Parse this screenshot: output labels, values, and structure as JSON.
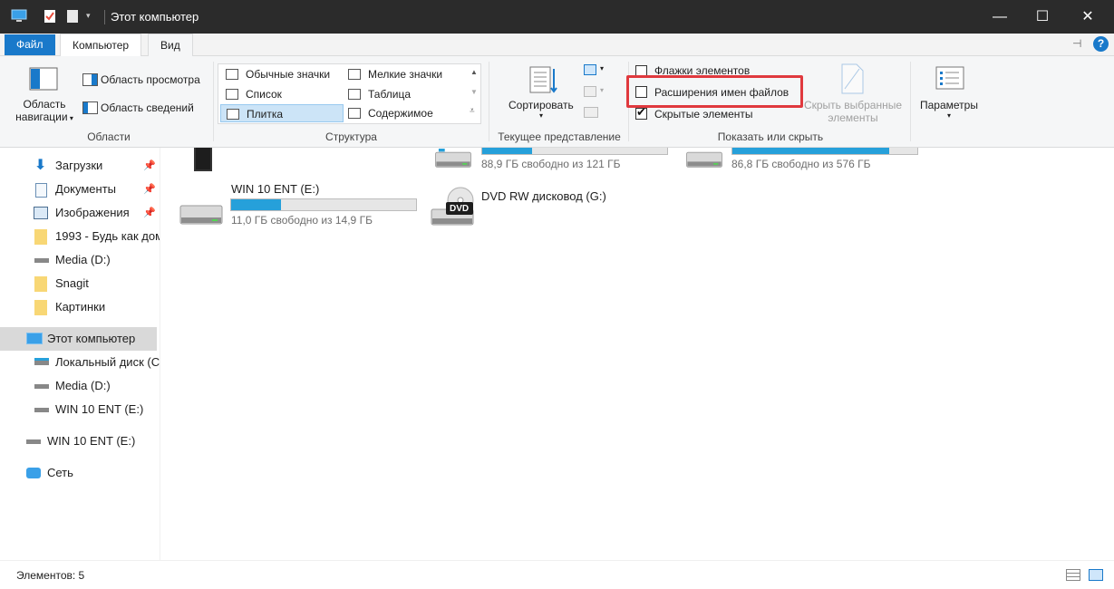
{
  "window": {
    "title": "Этот компьютер"
  },
  "tabs": [
    "Файл",
    "Компьютер",
    "Вид"
  ],
  "ribbon": {
    "panes": {
      "nav_pane": "Область навигации",
      "nav_pane_line1": "Область",
      "nav_pane_line2": "навигации",
      "preview": "Область просмотра",
      "details": "Область сведений",
      "group": "Области"
    },
    "layout": {
      "items": [
        "Обычные значки",
        "Мелкие значки",
        "Список",
        "Таблица",
        "Плитка",
        "Содержимое"
      ],
      "selected": "Плитка",
      "group": "Структура"
    },
    "current_view": {
      "sort": "Сортировать",
      "group": "Текущее представление"
    },
    "show_hide": {
      "item_checkboxes": "Флажки элементов",
      "file_extensions": "Расширения имен файлов",
      "hidden_items": "Скрытые элементы",
      "hide_selected_line1": "Скрыть выбранные",
      "hide_selected_line2": "элементы",
      "group": "Показать или скрыть"
    },
    "options": {
      "label": "Параметры"
    }
  },
  "nav": {
    "items": [
      {
        "label": "Загрузки",
        "pinned": true
      },
      {
        "label": "Документы",
        "pinned": true
      },
      {
        "label": "Изображения",
        "pinned": true
      },
      {
        "label": "1993 - Будь как дом"
      },
      {
        "label": "Media (D:)"
      },
      {
        "label": "Snagit"
      },
      {
        "label": "Картинки"
      },
      {
        "label": "Этот компьютер",
        "selected": true
      },
      {
        "label": "Локальный диск (C"
      },
      {
        "label": "Media (D:)"
      },
      {
        "label": "WIN 10 ENT (E:)"
      },
      {
        "label": "WIN 10 ENT (E:)"
      },
      {
        "label": "Сеть"
      }
    ]
  },
  "drives": [
    {
      "name": "",
      "free": "88,9 ГБ свободно из 121 ГБ",
      "used_fraction": 0.27
    },
    {
      "name": "",
      "free": "86,8 ГБ свободно из 576 ГБ",
      "used_fraction": 0.85
    },
    {
      "name": "WIN 10 ENT (E:)",
      "free": "11,0 ГБ свободно из 14,9 ГБ",
      "used_fraction": 0.27
    },
    {
      "name": "DVD RW дисковод (G:)",
      "dvd_label": "DVD"
    }
  ],
  "status": {
    "items_count": "Элементов: 5"
  },
  "colors": {
    "accent": "#1979ca",
    "bar": "#26a0da",
    "highlight": "#e0393e"
  }
}
